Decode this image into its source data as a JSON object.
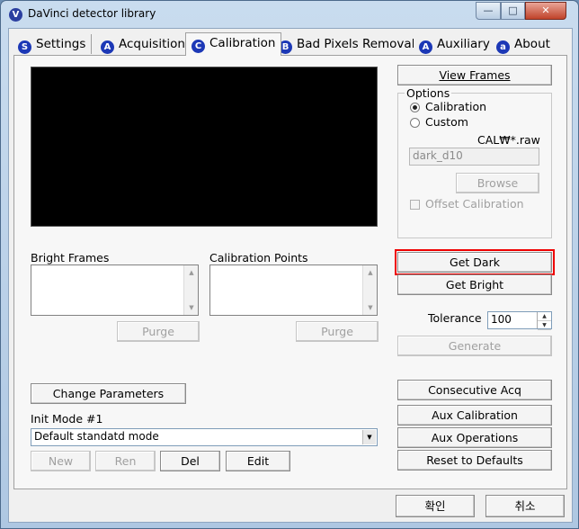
{
  "window": {
    "title": "DaVinci detector library",
    "app_icon_glyph": "V",
    "minimize_glyph": "—",
    "maximize_glyph": "□",
    "close_glyph": "✕"
  },
  "tabs": [
    {
      "icon_glyph": "S",
      "label": "Settings"
    },
    {
      "icon_glyph": "A",
      "label": "Acquisition"
    },
    {
      "icon_glyph": "C",
      "label": "Calibration",
      "active": true
    },
    {
      "icon_glyph": "B",
      "label": "Bad Pixels Removal"
    },
    {
      "icon_glyph": "A",
      "label": "Auxiliary"
    },
    {
      "icon_glyph": "a",
      "label": "About"
    }
  ],
  "left": {
    "bright_frames_label": "Bright Frames",
    "calibration_points_label": "Calibration Points",
    "purge_label": "Purge",
    "change_parameters_label": "Change Parameters",
    "init_mode_label": "Init Mode #1",
    "init_mode_value": "Default standatd mode",
    "buttons": {
      "new": "New",
      "ren": "Ren",
      "del": "Del",
      "edit": "Edit"
    }
  },
  "right": {
    "view_frames_label": "View Frames",
    "options_label": "Options",
    "radio_calibration": "Calibration",
    "radio_custom": "Custom",
    "file_pattern": "CAL₩*.raw",
    "file_field_value": "dark_d10",
    "browse_label": "Browse",
    "offset_calibration_label": "Offset Calibration",
    "get_dark_label": "Get Dark",
    "get_bright_label": "Get Bright",
    "tolerance_label": "Tolerance",
    "tolerance_value": "100",
    "generate_label": "Generate",
    "consecutive_acq_label": "Consecutive Acq",
    "aux_calibration_label": "Aux Calibration",
    "aux_operations_label": "Aux Operations",
    "reset_defaults_label": "Reset to Defaults"
  },
  "footer": {
    "ok_label": "확인",
    "cancel_label": "취소"
  },
  "colors": {
    "highlight_outline": "#e00000",
    "tab_icon": "#1c38b6"
  }
}
